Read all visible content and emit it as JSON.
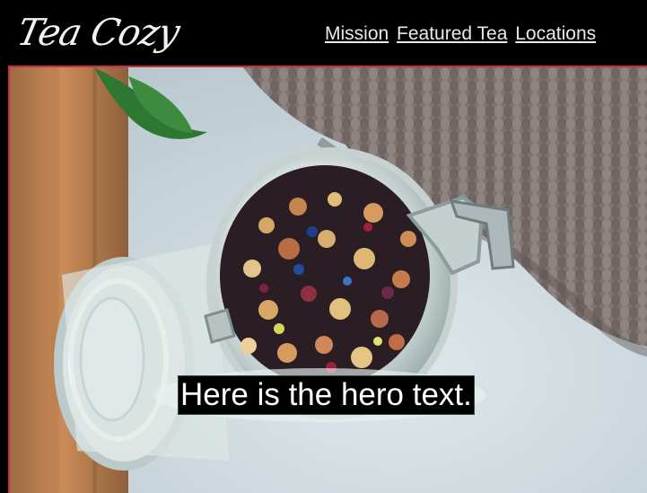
{
  "header": {
    "logo": "Tea Cozy",
    "nav": [
      {
        "label": "Mission"
      },
      {
        "label": "Featured Tea"
      },
      {
        "label": "Locations"
      }
    ]
  },
  "hero": {
    "text": "Here is the hero text."
  },
  "colors": {
    "page_background": "#000000",
    "hero_border": "#c92f3a",
    "nav_text": "#e9e9e9"
  }
}
